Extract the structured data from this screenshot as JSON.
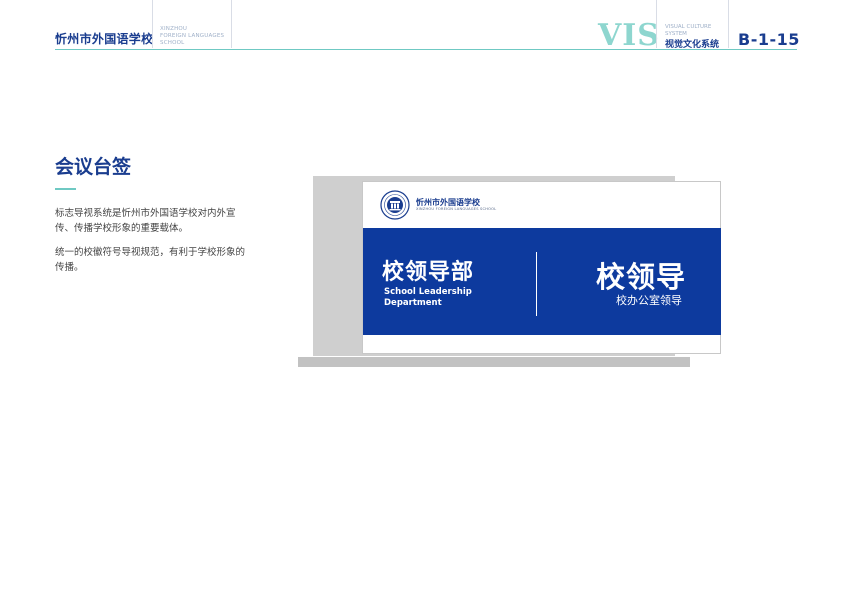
{
  "header": {
    "school_name": "忻州市外国语学校",
    "school_en": [
      "XINZHOU",
      "FOREIGN LANGUAGES",
      "SCHOOL"
    ],
    "vis": "VIS",
    "vc_en": [
      "VISUAL CULTURE",
      "SYSTEM"
    ],
    "vc_cn": "视觉文化系统",
    "page_number": "B-1-15"
  },
  "section": {
    "title": "会议台签",
    "paragraphs": [
      "标志导视系统是忻州市外国语学校对内外宣传、传播学校形象的重要载体。",
      "统一的校徽符号导视规范，有利于学校形象的传播。"
    ]
  },
  "sign": {
    "school_name": "忻州市外国语学校",
    "school_en": "XINZHOU FOREIGN LANGUAGES SCHOOL",
    "dept_cn": "校领导部",
    "dept_en": [
      "School Leadership",
      "Department"
    ],
    "name_cn": "校领导",
    "name_sub": "校办公室领导"
  },
  "colors": {
    "brand_blue": "#0d3a9e",
    "title_blue": "#1a3d8f",
    "accent_teal": "#6fc9c3"
  }
}
